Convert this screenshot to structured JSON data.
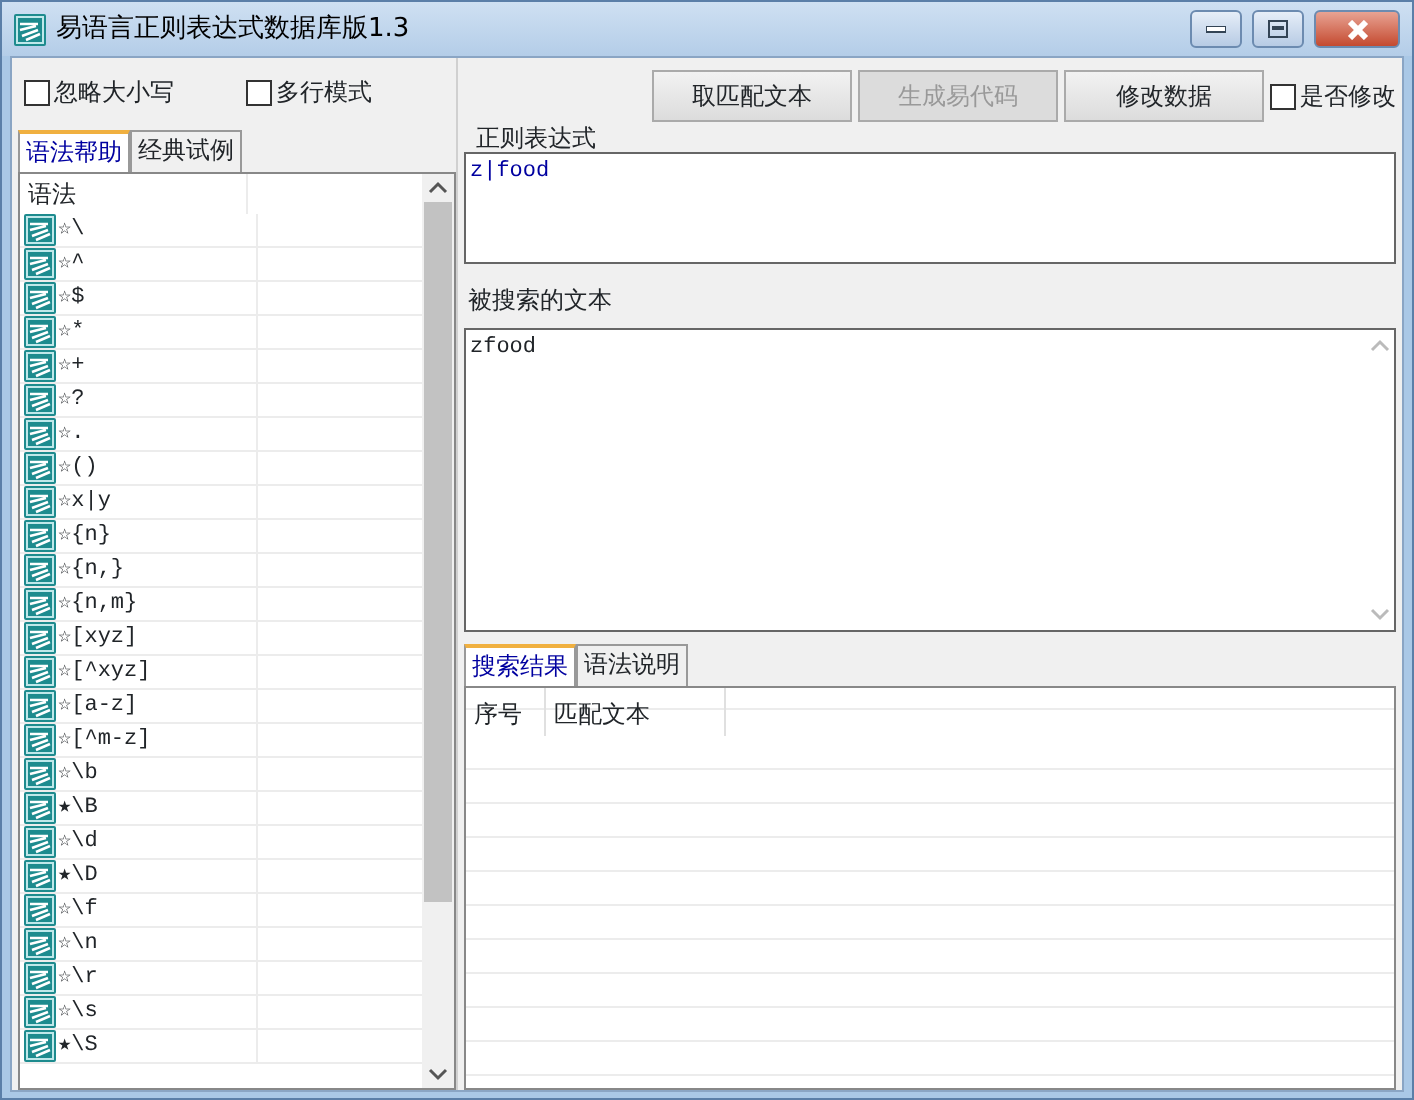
{
  "window": {
    "title": "易语言正则表达式数据库版1.3"
  },
  "options": [
    {
      "label": "忽略大小写",
      "checked": false
    },
    {
      "label": "多行模式",
      "checked": false
    }
  ],
  "left_tabs": [
    {
      "label": "语法帮助",
      "selected": true
    },
    {
      "label": "经典试例",
      "selected": false
    }
  ],
  "syntax_list": {
    "column": "语法",
    "items": [
      {
        "text": "☆\\"
      },
      {
        "text": "☆^"
      },
      {
        "text": "☆$"
      },
      {
        "text": "☆*"
      },
      {
        "text": "☆+"
      },
      {
        "text": "☆?"
      },
      {
        "text": "☆."
      },
      {
        "text": "☆()"
      },
      {
        "text": "☆x|y"
      },
      {
        "text": "☆{n}"
      },
      {
        "text": "☆{n,}"
      },
      {
        "text": "☆{n,m}"
      },
      {
        "text": "☆[xyz]"
      },
      {
        "text": "☆[^xyz]"
      },
      {
        "text": "☆[a-z]"
      },
      {
        "text": "☆[^m-z]"
      },
      {
        "text": "☆\\b"
      },
      {
        "text": "★\\B"
      },
      {
        "text": "☆\\d"
      },
      {
        "text": "★\\D"
      },
      {
        "text": "☆\\f"
      },
      {
        "text": "☆\\n"
      },
      {
        "text": "☆\\r"
      },
      {
        "text": "☆\\s"
      },
      {
        "text": "★\\S"
      }
    ]
  },
  "buttons": [
    {
      "label": "取匹配文本",
      "disabled": false
    },
    {
      "label": "生成易代码",
      "disabled": true
    },
    {
      "label": "修改数据",
      "disabled": false
    }
  ],
  "modify_option": {
    "label": "是否修改",
    "checked": false
  },
  "regex": {
    "label": "正则表达式",
    "value": "z|food"
  },
  "search_text": {
    "label": "被搜索的文本",
    "value": "zfood"
  },
  "result_tabs": [
    {
      "label": "搜索结果",
      "selected": true
    },
    {
      "label": "语法说明",
      "selected": false
    }
  ],
  "results": {
    "columns": [
      "序号",
      "匹配文本"
    ]
  }
}
